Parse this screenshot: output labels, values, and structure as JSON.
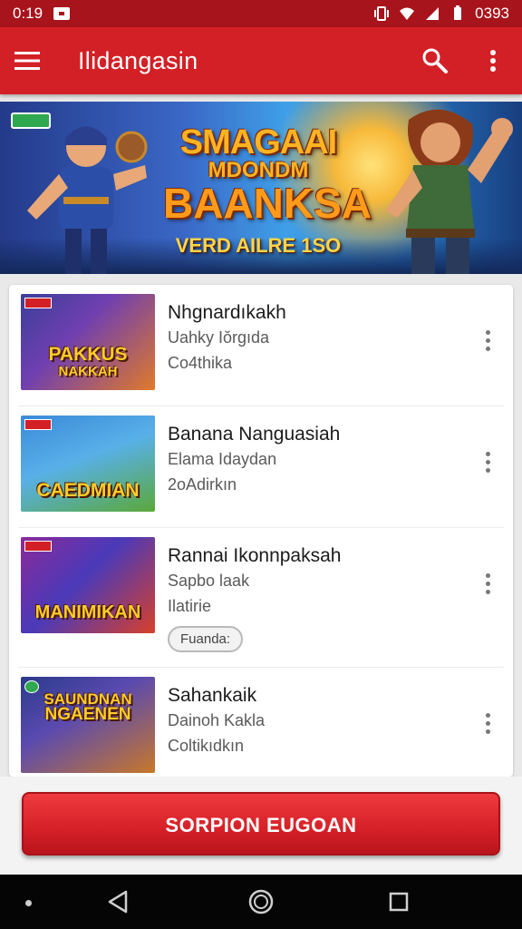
{
  "status_bar": {
    "time": "0:19",
    "battery_text": "0393"
  },
  "app_bar": {
    "title": "Ilidangasin",
    "menu_icon": "hamburger-menu-icon",
    "search_icon": "search-icon",
    "overflow_icon": "more-vert-icon"
  },
  "banner": {
    "line1": "SMAGAAI",
    "line2": "MDONDM",
    "line3": "BAANKSA",
    "line4": "VERD AILRE 1SO"
  },
  "items": [
    {
      "title": "Nhgnardıkakh",
      "subtitle": "Uahky Iŏrgıda",
      "meta": "Co4thika",
      "thumb_title": "PAKKUS",
      "thumb_sub": "NAKKAH"
    },
    {
      "title": "Banana Nanguasiah",
      "subtitle": "Elama Idaydan",
      "meta": "2oAdirkın",
      "thumb_title": "CAEDMIAN",
      "thumb_sub": ""
    },
    {
      "title": "Rannai Ikonnpaksah",
      "subtitle": "Sapbo laak",
      "meta": "Ilatirie",
      "chip": "Fuanda:",
      "thumb_title": "MANIMIKAN",
      "thumb_sub": ""
    },
    {
      "title": "Sahankaik",
      "subtitle": "Dainoh Kakla",
      "meta": "Coltikıdkın",
      "thumb_title": "SAUNDNAN",
      "thumb_sub": "NGAENEN"
    }
  ],
  "cta": {
    "label": "SORPION EUGOAN"
  },
  "nav": {
    "back_icon": "back-triangle-icon",
    "home_icon": "home-circle-icon",
    "recents_icon": "recents-square-icon"
  },
  "colors": {
    "primary": "#d32026",
    "primary_dark": "#a8141c",
    "accent": "#ffb323"
  }
}
